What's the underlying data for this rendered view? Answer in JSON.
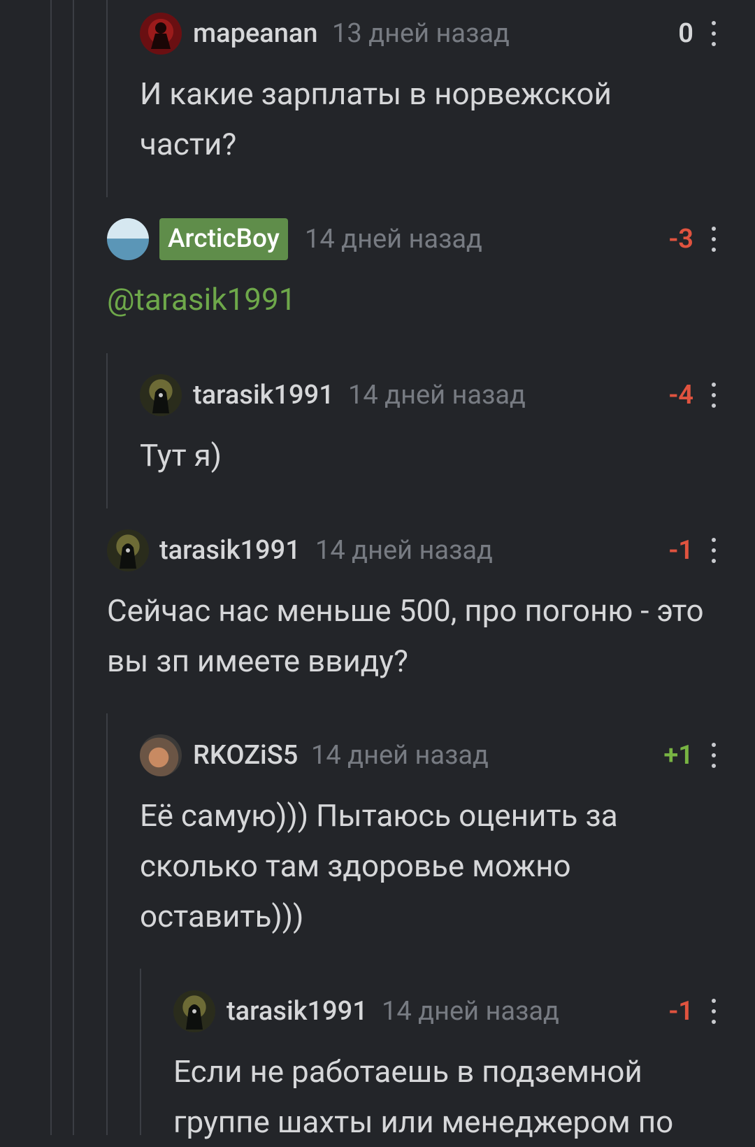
{
  "comments": [
    {
      "author": "mapeanan",
      "time": "13 дней назад",
      "score": "0",
      "text": "И какие зарплаты в норвежской части?",
      "avatar_icon": "red-user-avatar-icon"
    },
    {
      "author": "ArcticBoy",
      "time": "14 дней назад",
      "score": "-3",
      "mention": "@tarasik1991",
      "avatar_icon": "sea-horizon-avatar-icon"
    },
    {
      "author": "tarasik1991",
      "time": "14 дней назад",
      "score": "-4",
      "text": "Тут я)",
      "avatar_icon": "hooded-figure-avatar-icon"
    },
    {
      "author": "tarasik1991",
      "time": "14 дней назад",
      "score": "-1",
      "text": "Сейчас нас меньше 500, про погоню - это вы зп имеете ввиду?",
      "avatar_icon": "hooded-figure-avatar-icon"
    },
    {
      "author": "RKOZiS5",
      "time": "14 дней назад",
      "score": "+1",
      "text": "Её самую))) Пытаюсь оценить за сколько там здоровье можно оставить)))",
      "avatar_icon": "photo-avatar-icon"
    },
    {
      "author": "tarasik1991",
      "time": "14 дней назад",
      "score": "-1",
      "text": "Если не работаешь в подземной группе шахты или менеджером по",
      "avatar_icon": "hooded-figure-avatar-icon"
    }
  ],
  "colors": {
    "background": "#232529",
    "negative_score": "#e0533f",
    "positive_score": "#78b443",
    "author_badge": "#5f8d4a",
    "mention": "#6ea84a"
  }
}
